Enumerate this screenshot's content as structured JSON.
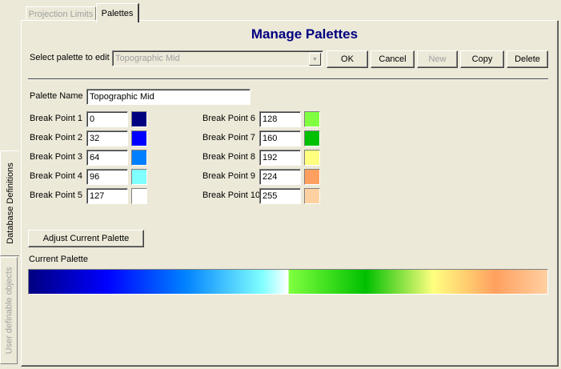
{
  "side_tabs": {
    "database_definitions": "Database Definitions",
    "user_definable_objects": "User definable objects"
  },
  "tabs": {
    "projection_limits": "Projection Limits",
    "palettes": "Palettes"
  },
  "title": "Manage Palettes",
  "select_palette": {
    "label": "Select palette to edit",
    "value": "Topographic Mid"
  },
  "buttons": {
    "ok": "OK",
    "cancel": "Cancel",
    "new": "New",
    "copy": "Copy",
    "delete": "Delete",
    "adjust": "Adjust Current Palette"
  },
  "palette_name": {
    "label": "Palette Name",
    "value": "Topographic Mid"
  },
  "break_points": [
    {
      "label": "Break Point 1",
      "value": "0",
      "color": "#000080"
    },
    {
      "label": "Break Point 2",
      "value": "32",
      "color": "#0000ff"
    },
    {
      "label": "Break Point 3",
      "value": "64",
      "color": "#0080ff"
    },
    {
      "label": "Break Point 4",
      "value": "96",
      "color": "#80ffff"
    },
    {
      "label": "Break Point 5",
      "value": "127",
      "color": "#ffffff"
    },
    {
      "label": "Break Point 6",
      "value": "128",
      "color": "#80ff40"
    },
    {
      "label": "Break Point 7",
      "value": "160",
      "color": "#00c000"
    },
    {
      "label": "Break Point 8",
      "value": "192",
      "color": "#ffff80"
    },
    {
      "label": "Break Point 9",
      "value": "224",
      "color": "#ffa060"
    },
    {
      "label": "Break Point 10",
      "value": "255",
      "color": "#ffd0a0"
    }
  ],
  "current_palette_label": "Current Palette"
}
